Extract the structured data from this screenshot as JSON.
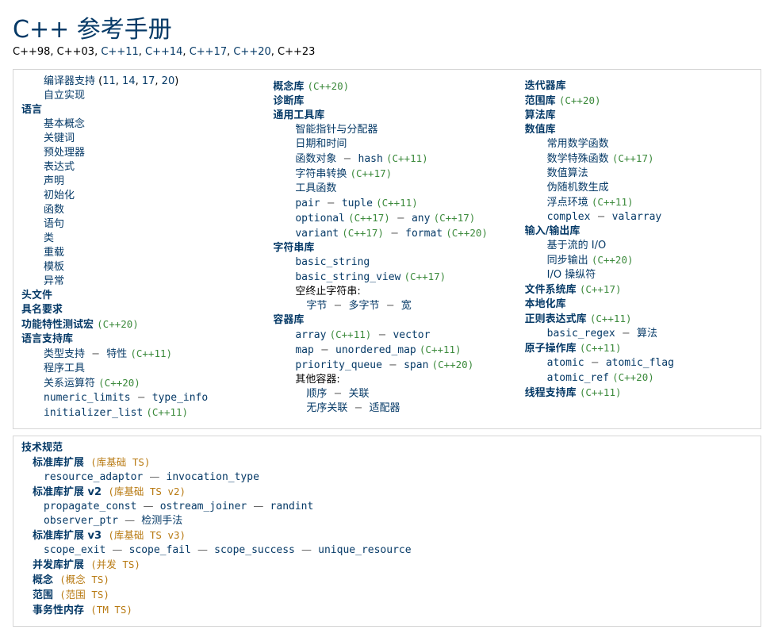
{
  "header": {
    "title": "C++ 参考手册",
    "subtitle_plain": [
      "C++98",
      ", ",
      "C++03",
      ", "
    ],
    "subtitle_links": [
      "C++11",
      "C++14",
      "C++17",
      "C++20"
    ],
    "subtitle_tail": ", C++23"
  },
  "col_a": {
    "compiler_support": {
      "label": "编译器支持",
      "open": " (",
      "nums": [
        "11",
        "14",
        "17",
        "20"
      ],
      "close": ")"
    },
    "self_build": "自立实现",
    "language": "语言",
    "lang_items": [
      "基本概念",
      "关键词",
      "预处理器",
      "表达式",
      "声明",
      "初始化",
      "函数",
      "语句",
      "类",
      "重载",
      "模板",
      "异常"
    ],
    "headers": "头文件",
    "name_req": "具名要求",
    "feat_macro": {
      "label": "功能特性测试宏",
      "tag": "(C++20)"
    },
    "lang_support": "语言支持库",
    "type_support": {
      "a": "类型支持",
      "sep": "−",
      "b": "特性",
      "tag": "(C++11)"
    },
    "program_utils": "程序工具",
    "rel_ops": {
      "label": "关系运算符",
      "tag": "(C++20)"
    },
    "numeric_limits": {
      "a": "numeric_limits",
      "sep": "−",
      "b": "type_info"
    },
    "init_list": {
      "a": "initializer_list",
      "tag": "(C++11)"
    }
  },
  "col_b": {
    "concepts": {
      "label": "概念库",
      "tag": "(C++20)"
    },
    "diag": "诊断库",
    "utils": "通用工具库",
    "smart_ptr": "智能指针与分配器",
    "date_time": "日期和时间",
    "func_obj": {
      "a": "函数对象",
      "sep": "−",
      "b": "hash",
      "tag": "(C++11)"
    },
    "str_conv": {
      "label": "字符串转换",
      "tag": "(C++17)"
    },
    "util_fns": "工具函数",
    "pair_tuple": {
      "a": "pair",
      "sep": "−",
      "b": "tuple",
      "tag": "(C++11)"
    },
    "opt_any": {
      "a": "optional",
      "atag": "(C++17)",
      "sep": "−",
      "b": "any",
      "btag": "(C++17)"
    },
    "var_fmt": {
      "a": "variant",
      "atag": "(C++17)",
      "sep": "−",
      "b": "format",
      "btag": "(C++20)"
    },
    "strings": "字符串库",
    "basic_string": "basic_string",
    "string_view": {
      "a": "basic_string_view",
      "tag": "(C++17)"
    },
    "null_term": "空终止字符串:",
    "char_types": {
      "a": "字节",
      "b": "多字节",
      "c": "宽"
    },
    "containers": "容器库",
    "arr_vec": {
      "a": "array",
      "atag": "(C++11)",
      "sep": "−",
      "b": "vector"
    },
    "map_umap": {
      "a": "map",
      "sep": "−",
      "b": "unordered_map",
      "tag": "(C++11)"
    },
    "pq_span": {
      "a": "priority_queue",
      "sep": "−",
      "b": "span",
      "tag": "(C++20)"
    },
    "other": "其他容器:",
    "seq_assoc": {
      "a": "顺序",
      "b": "关联"
    },
    "unord_adapt": {
      "a": "无序关联",
      "b": "适配器"
    }
  },
  "col_c": {
    "iter": "迭代器库",
    "ranges": {
      "label": "范围库",
      "tag": "(C++20)"
    },
    "algo": "算法库",
    "numeric": "数值库",
    "common_math": "常用数学函数",
    "special_math": {
      "label": "数学特殊函数",
      "tag": "(C++17)"
    },
    "numeric_algo": "数值算法",
    "prng": "伪随机数生成",
    "fenv": {
      "label": "浮点环境",
      "tag": "(C++11)"
    },
    "complex_valarray": {
      "a": "complex",
      "sep": "−",
      "b": "valarray"
    },
    "io": "输入/输出库",
    "stream_io": "基于流的 I/O",
    "sync_out": {
      "label": "同步输出",
      "tag": "(C++20)"
    },
    "io_manip": "I/O 操纵符",
    "fs": {
      "label": "文件系统库",
      "tag": "(C++17)"
    },
    "local": "本地化库",
    "regex": {
      "label": "正则表达式库",
      "tag": "(C++11)"
    },
    "regex_algo": {
      "a": "basic_regex",
      "sep": "−",
      "b": "算法"
    },
    "atomic": {
      "label": "原子操作库",
      "tag": "(C++11)"
    },
    "atomic_flag": {
      "a": "atomic",
      "sep": "−",
      "b": "atomic_flag"
    },
    "atomic_ref": {
      "a": "atomic_ref",
      "tag": "(C++20)"
    },
    "thread": {
      "label": "线程支持库",
      "tag": "(C++11)"
    }
  },
  "ts": {
    "title": "技术规范",
    "ext1": {
      "label": "标准库扩展",
      "tag": "(库基础 TS)"
    },
    "ext1_line": {
      "a": "resource_adaptor",
      "sep": "—",
      "b": "invocation_type"
    },
    "ext2": {
      "label": "标准库扩展 v2",
      "tag": "(库基础 TS v2)"
    },
    "ext2_line1": {
      "a": "propagate_const",
      "b": "ostream_joiner",
      "c": "randint"
    },
    "ext2_line2": {
      "a": "observer_ptr",
      "b": "检测手法"
    },
    "ext3": {
      "label": "标准库扩展 v3",
      "tag": "(库基础 TS v3)"
    },
    "ext3_line": {
      "a": "scope_exit",
      "b": "scope_fail",
      "c": "scope_success",
      "d": "unique_resource"
    },
    "concurrency": {
      "label": "并发库扩展",
      "tag": "(并发 TS)"
    },
    "concepts": {
      "label": "概念",
      "tag": "(概念 TS)"
    },
    "ranges": {
      "label": "范围",
      "tag": "(范围 TS)"
    },
    "tm": {
      "label": "事务性内存",
      "tag": "(TM TS)"
    }
  }
}
